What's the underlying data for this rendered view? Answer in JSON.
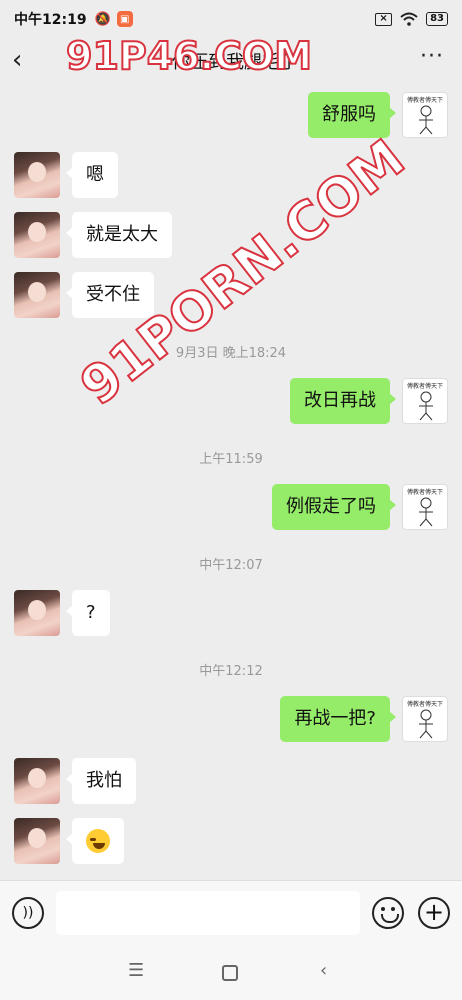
{
  "status_bar": {
    "time": "中午12:19",
    "battery": "83"
  },
  "header": {
    "back_icon": "‹",
    "title": "你压到我腿毛了",
    "more_icon": "···"
  },
  "watermarks": {
    "top": "91P46.COM",
    "diagonal": "91PORN.COM"
  },
  "messages": [
    {
      "type": "out",
      "text": "舒服吗",
      "avatar_caption": "傅教者傅天下"
    },
    {
      "type": "in",
      "text": "嗯"
    },
    {
      "type": "in",
      "text": "就是太大"
    },
    {
      "type": "in",
      "text": "受不住"
    },
    {
      "type": "time",
      "text": "9月3日 晚上18:24"
    },
    {
      "type": "out",
      "text": "改日再战",
      "avatar_caption": "傅教者傅天下"
    },
    {
      "type": "time",
      "text": "上午11:59"
    },
    {
      "type": "out",
      "text": "例假走了吗",
      "avatar_caption": "傅教者傅天下"
    },
    {
      "type": "time",
      "text": "中午12:07"
    },
    {
      "type": "in",
      "text": "?"
    },
    {
      "type": "time",
      "text": "中午12:12"
    },
    {
      "type": "out",
      "text": "再战一把?",
      "avatar_caption": "傅教者傅天下"
    },
    {
      "type": "in",
      "text": "我怕"
    },
    {
      "type": "in",
      "emoji": "laugh-cry-emoji"
    }
  ],
  "input_bar": {
    "placeholder": ""
  },
  "nav": {
    "menu_icon": "☰",
    "back_icon": "‹"
  }
}
